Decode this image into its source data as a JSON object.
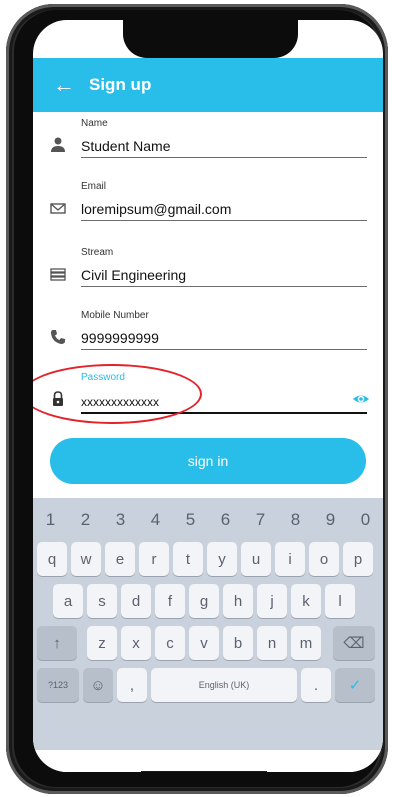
{
  "header": {
    "title": "Sign up",
    "back_icon": "arrow-left-icon"
  },
  "form": {
    "name": {
      "label": "Name",
      "value": "Student Name",
      "icon": "person-icon"
    },
    "email": {
      "label": "Email",
      "value": "loremipsum@gmail.com",
      "icon": "mail-icon"
    },
    "stream": {
      "label": "Stream",
      "value": "Civil Engineering",
      "icon": "books-icon"
    },
    "mobile": {
      "label": "Mobile Number",
      "value": "9999999999",
      "icon": "phone-icon"
    },
    "password": {
      "label": "Password",
      "value": "xxxxxxxxxxxxx",
      "icon": "lock-icon",
      "toggle_icon": "eye-icon"
    }
  },
  "buttons": {
    "submit": "sign in"
  },
  "keyboard": {
    "number_row": [
      "1",
      "2",
      "3",
      "4",
      "5",
      "6",
      "7",
      "8",
      "9",
      "0"
    ],
    "row1": [
      "q",
      "w",
      "e",
      "r",
      "t",
      "y",
      "u",
      "i",
      "o",
      "p"
    ],
    "row2": [
      "a",
      "s",
      "d",
      "f",
      "g",
      "h",
      "j",
      "k",
      "l"
    ],
    "row3": [
      "↑",
      "z",
      "x",
      "c",
      "v",
      "b",
      "n",
      "m",
      "⌫"
    ],
    "row4": {
      "sym": "?123",
      "emoji": "☺",
      "comma": ",",
      "space": "English (UK)",
      "period": ".",
      "enter": "✓"
    }
  },
  "colors": {
    "accent": "#29bde9",
    "annotation": "#e52129"
  }
}
